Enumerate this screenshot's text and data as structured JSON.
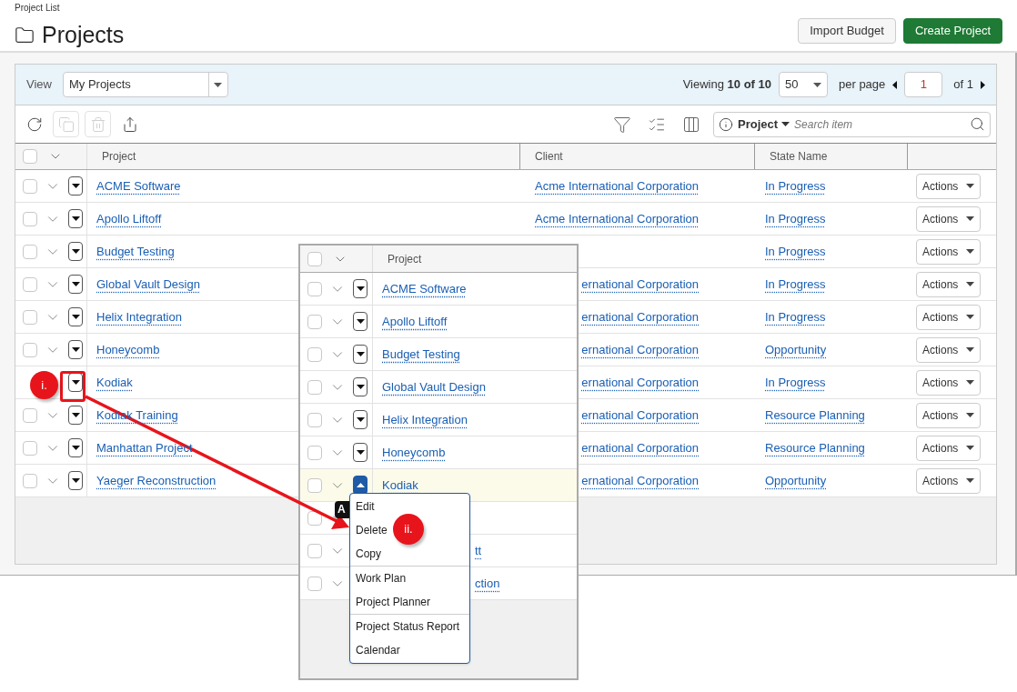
{
  "breadcrumb": "Project List",
  "title": "Projects",
  "header_buttons": [
    {
      "label": "Import Budget",
      "kind": "secondary"
    },
    {
      "label": "Create Project",
      "kind": "primary"
    }
  ],
  "view": {
    "label": "View",
    "value": "My Projects"
  },
  "paging": {
    "viewing": "Viewing **10 of 10**",
    "per_page": "50",
    "per_page_label": "per page",
    "page": "1",
    "of": "of 1"
  },
  "toolbar": [
    {
      "kind": "refresh",
      "disabled": false
    },
    {
      "kind": "copy",
      "disabled": true
    },
    {
      "kind": "delete",
      "disabled": true
    },
    {
      "kind": "export",
      "disabled": false
    }
  ],
  "search": {
    "field": "Project",
    "placeholder": "Search item"
  },
  "table": {
    "header_checked": false,
    "columns": [
      "Project",
      "Client",
      "State Name"
    ],
    "rows": [
      {
        "checked": false,
        "project": "ACME Software",
        "client": "Acme International Corporation",
        "state": "In Progress",
        "action": "Actions"
      },
      {
        "checked": false,
        "project": "Apollo Liftoff",
        "client": "Acme International Corporation",
        "state": "In Progress",
        "action": "Actions"
      },
      {
        "checked": false,
        "project": "Budget Testing",
        "state": "In Progress",
        "action": "Actions"
      },
      {
        "checked": false,
        "project": "Global Vault Design",
        "client": "ernational Corporation",
        "state": "In Progress",
        "action": "Actions"
      },
      {
        "checked": false,
        "project": "Helix Integration",
        "client": "ernational Corporation",
        "state": "In Progress",
        "action": "Actions"
      },
      {
        "checked": false,
        "project": "Honeycomb",
        "client": "ernational Corporation",
        "state": "Opportunity",
        "action": "Actions"
      },
      {
        "project": "Kodiak",
        "client": "ernational Corporation",
        "state": "In Progress",
        "action": "Actions"
      },
      {
        "checked": false,
        "project": "Kodiak Training",
        "client": "ernational Corporation",
        "state": "Resource Planning",
        "action": "Actions"
      },
      {
        "checked": false,
        "project": "Manhattan Project",
        "client": "ernational Corporation",
        "state": "Resource Planning",
        "action": "Actions"
      },
      {
        "checked": false,
        "project": "Yaeger Reconstruction",
        "client": "ernational Corporation",
        "state": "Opportunity",
        "action": "Actions"
      }
    ]
  },
  "inset": {
    "header_checked": false,
    "column": "Project",
    "rows": [
      {
        "checked": false,
        "selected": false,
        "expanded": false,
        "project": "ACME Software"
      },
      {
        "checked": false,
        "selected": false,
        "expanded": false,
        "project": "Apollo Liftoff"
      },
      {
        "checked": false,
        "selected": false,
        "expanded": false,
        "project": "Budget Testing"
      },
      {
        "checked": false,
        "selected": false,
        "expanded": false,
        "project": "Global Vault Design"
      },
      {
        "checked": false,
        "selected": false,
        "expanded": false,
        "project": "Helix Integration"
      },
      {
        "checked": false,
        "selected": false,
        "expanded": false,
        "project": "Honeycomb"
      },
      {
        "checked": false,
        "selected": true,
        "expanded": true,
        "project": "Kodiak"
      },
      {
        "checked": false,
        "selected": false
      },
      {
        "checked": false,
        "selected": false,
        "project": "tt"
      },
      {
        "checked": false,
        "selected": false,
        "project": "ction"
      }
    ]
  },
  "menu": {
    "groups": [
      [
        "Edit",
        "Delete",
        "Copy"
      ],
      [
        "Work Plan",
        "Project Planner"
      ],
      [
        "Project Status Report",
        "Calendar"
      ]
    ]
  },
  "tooltip": "A",
  "annotations": [
    "i.",
    "ii."
  ]
}
